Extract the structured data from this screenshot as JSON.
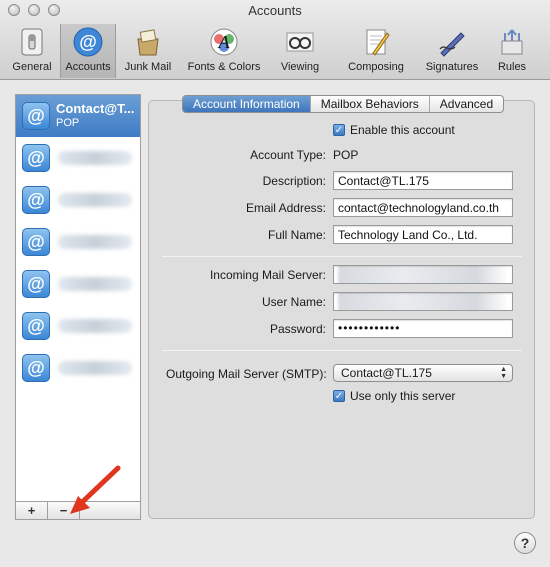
{
  "window": {
    "title": "Accounts"
  },
  "toolbar": {
    "items": [
      {
        "label": "General",
        "icon": "switch-icon"
      },
      {
        "label": "Accounts",
        "icon": "at-sign-icon",
        "selected": true
      },
      {
        "label": "Junk Mail",
        "icon": "junk-mail-icon"
      },
      {
        "label": "Fonts & Colors",
        "icon": "color-font-icon"
      },
      {
        "label": "Viewing",
        "icon": "glasses-icon"
      },
      {
        "label": "Composing",
        "icon": "pencil-paper-icon"
      },
      {
        "label": "Signatures",
        "icon": "signature-pen-icon"
      },
      {
        "label": "Rules",
        "icon": "rules-arrows-icon"
      }
    ]
  },
  "accounts": {
    "selected": {
      "name": "Contact@T...",
      "type": "POP"
    },
    "add_label": "+",
    "remove_label": "−"
  },
  "tabs": [
    "Account Information",
    "Mailbox Behaviors",
    "Advanced"
  ],
  "form": {
    "enable_label": "Enable this account",
    "enable_checked": true,
    "account_type_label": "Account Type:",
    "account_type_value": "POP",
    "description_label": "Description:",
    "description_value": "Contact@TL.175",
    "email_label": "Email Address:",
    "email_value": "contact@technologyland.co.th",
    "fullname_label": "Full Name:",
    "fullname_value": "Technology Land Co., Ltd.",
    "incoming_label": "Incoming Mail Server:",
    "username_label": "User Name:",
    "password_label": "Password:",
    "password_value": "••••••••••••",
    "outgoing_label": "Outgoing Mail Server (SMTP):",
    "outgoing_value": "Contact@TL.175",
    "use_only_label": "Use only this server",
    "use_only_checked": true
  },
  "help": {
    "label": "?"
  },
  "colors": {
    "selection": "#3f7cc5",
    "arrow": "#e0351f"
  }
}
